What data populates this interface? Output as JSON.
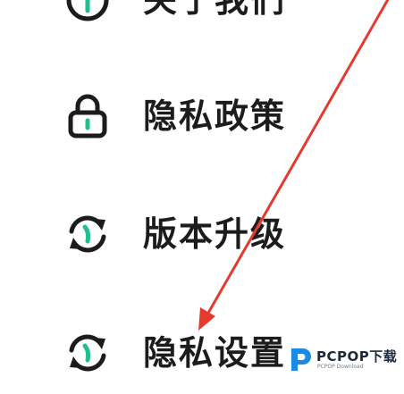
{
  "menu": {
    "items": [
      {
        "label": "关于我们",
        "icon": "info-icon"
      },
      {
        "label": "隐私政策",
        "icon": "lock-icon"
      },
      {
        "label": "版本升级",
        "icon": "refresh-icon"
      },
      {
        "label": "隐私设置",
        "icon": "refresh-icon"
      }
    ]
  },
  "annotation": {
    "arrow_color": "#e53a2e"
  },
  "watermark": {
    "main_text": "PCPOP下载",
    "sub_text": "PCPOP Download",
    "logo_icon": "pcpop-logo-icon",
    "logo_color": "#1a8ae6"
  },
  "colors": {
    "text": "#1c1c1c",
    "icon_accent": "#1fbf8f"
  }
}
